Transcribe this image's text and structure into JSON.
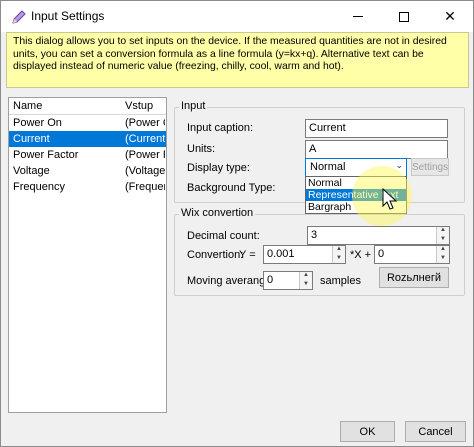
{
  "window": {
    "title": "Input Settings",
    "close_glyph": "✕",
    "maximize_glyph": "☐"
  },
  "info_text": "This dialog allows you to set inputs on the device. If the measured quantities are not in desired units, you can set a conversion formula as a line formula (y=kx+q). Alternative text can be displayed instead of numeric value (freezing, chilly, cool, warm and hot).",
  "list": {
    "col_name": "Name",
    "col_input": "Vstup",
    "rows": [
      {
        "name": "Power On",
        "input": "(Power On)"
      },
      {
        "name": "Current",
        "input": "(Current)"
      },
      {
        "name": "Power Factor",
        "input": "(Power Factor)"
      },
      {
        "name": "Voltage",
        "input": "(Voltage)"
      },
      {
        "name": "Frequency",
        "input": "(Frequency)"
      }
    ],
    "selected_index": 1
  },
  "input_group": {
    "title": "Input",
    "caption_label": "Input caption:",
    "caption_value": "Current",
    "units_label": "Units:",
    "units_value": "A",
    "display_type_label": "Display type:",
    "display_type_value": "Normal",
    "display_type_options": [
      "Normal",
      "Representative text",
      "Bargraph"
    ],
    "display_type_highlighted": "Representative text",
    "settings_label": "Settings",
    "background_type_label": "Background Type:"
  },
  "conversion_group": {
    "title": "Wix convertion",
    "decimal_label": "Decimal count:",
    "decimal_value": "3",
    "conversion_label": "Convertion:",
    "y_eq": "Y =",
    "k_value": "0.001",
    "x_plus": "*X +",
    "q_value": "0",
    "moving_label": "Moving averange:",
    "moving_value": "0",
    "samples_label": "samples",
    "extra_button_label": "Rozьлнeгй"
  },
  "footer": {
    "ok_label": "OK",
    "cancel_label": "Cancel"
  },
  "colors": {
    "accent": "#0078d7",
    "info_bg": "#ffffa8",
    "pen_icon": "#8e5fc1"
  }
}
